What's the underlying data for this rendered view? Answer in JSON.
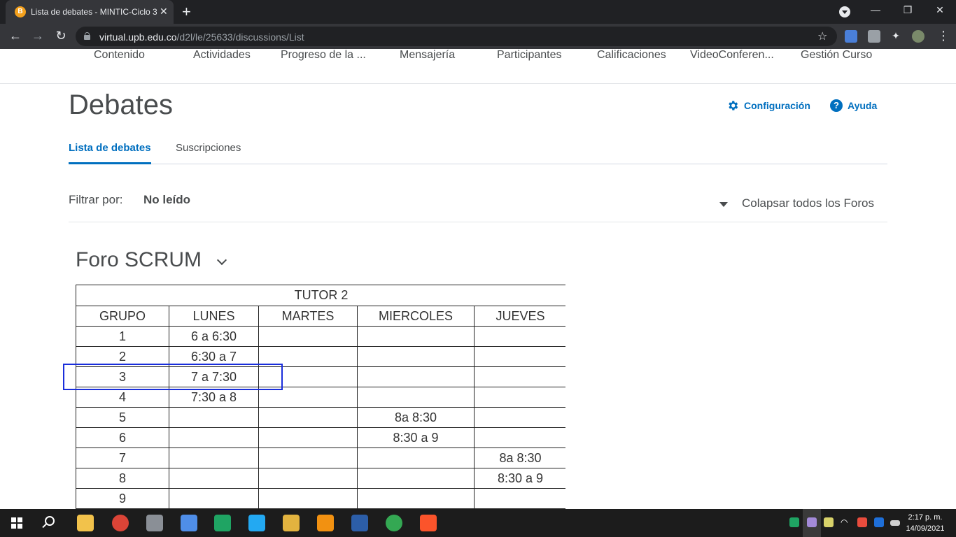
{
  "browser": {
    "tab_title": "Lista de debates - MINTIC-Ciclo 3",
    "url_domain": "virtual.upb.edu.co",
    "url_path": "/d2l/le/25633/discussions/List"
  },
  "coursenav": {
    "items": [
      "Contenido",
      "Actividades",
      "Progreso de la ...",
      "Mensajería",
      "Participantes",
      "Calificaciones",
      "VideoConferen...",
      "Gestión Curso"
    ]
  },
  "page": {
    "title": "Debates",
    "settings_label": "Configuración",
    "help_label": "Ayuda",
    "tabs": [
      "Lista de debates",
      "Suscripciones"
    ],
    "filter_label": "Filtrar por:",
    "filter_value": "No leído",
    "collapse_label": "Colapsar todos los Foros",
    "forum_title": "Foro SCRUM"
  },
  "schedule": {
    "title": "TUTOR 2",
    "headers": [
      "GRUPO",
      "LUNES",
      "MARTES",
      "MIERCOLES",
      "JUEVES"
    ],
    "rows": [
      [
        "1",
        "6 a 6:30",
        "",
        "",
        ""
      ],
      [
        "2",
        "6:30 a 7",
        "",
        "",
        ""
      ],
      [
        "3",
        "7 a 7:30",
        "",
        "",
        ""
      ],
      [
        "4",
        "7:30 a 8",
        "",
        "",
        ""
      ],
      [
        "5",
        "",
        "",
        "8a 8:30",
        ""
      ],
      [
        "6",
        "",
        "",
        "8:30 a 9",
        ""
      ],
      [
        "7",
        "",
        "",
        "",
        "8a 8:30"
      ],
      [
        "8",
        "",
        "",
        "",
        "8:30 a 9"
      ],
      [
        "9",
        "",
        "",
        "",
        ""
      ]
    ],
    "highlight_color": "#1a2edb"
  },
  "taskbar": {
    "time": "2:17 p. m.",
    "date": "14/09/2021"
  },
  "colors": {
    "accent": "#006fbf",
    "text": "#494c4e",
    "chrome_dark": "#202124"
  }
}
